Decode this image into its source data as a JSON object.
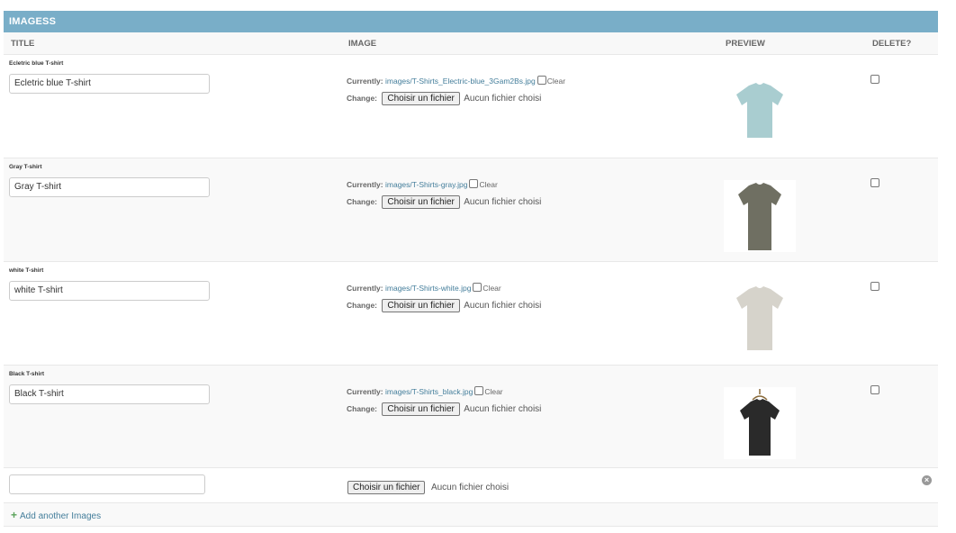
{
  "module": {
    "caption": "Imagess"
  },
  "columns": {
    "title": "Title",
    "image": "Image",
    "preview": "Preview",
    "delete": "Delete?"
  },
  "rows": [
    {
      "label": "Ecletric blue T-shirt",
      "value": "Ecletric blue T-shirt",
      "currently_label": "Currently:",
      "file": "images/T-Shirts_Electric-blue_3Gam2Bs.jpg",
      "clear_label": "Clear",
      "change_label": "Change:",
      "button": "Choisir un fichier",
      "no_file": "Aucun fichier choisi",
      "shirt_color": "#a9cdd0"
    },
    {
      "label": "Gray T-shirt",
      "value": "Gray T-shirt",
      "currently_label": "Currently:",
      "file": "images/T-Shirts-gray.jpg",
      "clear_label": "Clear",
      "change_label": "Change:",
      "button": "Choisir un fichier",
      "no_file": "Aucun fichier choisi",
      "shirt_color": "#6f6f62"
    },
    {
      "label": "white T-shirt",
      "value": "white T-shirt",
      "currently_label": "Currently:",
      "file": "images/T-Shirts-white.jpg",
      "clear_label": "Clear",
      "change_label": "Change:",
      "button": "Choisir un fichier",
      "no_file": "Aucun fichier choisi",
      "shirt_color": "#d6d3cb"
    },
    {
      "label": "Black T-shirt",
      "value": "Black T-shirt",
      "currently_label": "Currently:",
      "file": "images/T-Shirts_black.jpg",
      "clear_label": "Clear",
      "change_label": "Change:",
      "button": "Choisir un fichier",
      "no_file": "Aucun fichier choisi",
      "shirt_color": "#2a2a2a"
    }
  ],
  "new_row": {
    "button": "Choisir un fichier",
    "no_file": "Aucun fichier choisi",
    "value": ""
  },
  "add_link": {
    "label": "Add another Images"
  },
  "colors": {
    "caption_bg": "#79aec8",
    "link": "#447e9b",
    "add_icon": "#5ba35b"
  }
}
